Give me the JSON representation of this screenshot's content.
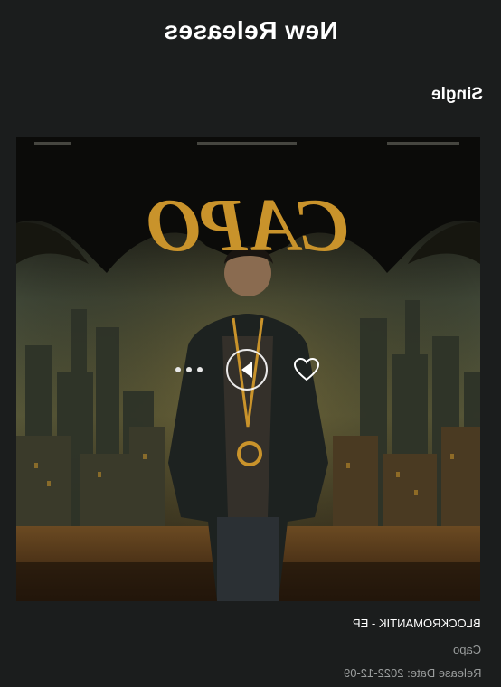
{
  "header": {
    "title": "New Releases"
  },
  "section": {
    "title": "Single"
  },
  "release": {
    "cover_text": "CAPO",
    "album_title": "BLOCKROMANTIK - EP",
    "artist": "Capo",
    "release_date_label": "Release Date: 2022-12-09"
  },
  "controls": {
    "more_icon": "more-dots-icon",
    "play_icon": "play-icon",
    "favorite_icon": "heart-outline-icon"
  },
  "colors": {
    "background": "#1b1d1d",
    "title_gold": "#c9932b",
    "muted_text": "#9a9d9d"
  }
}
